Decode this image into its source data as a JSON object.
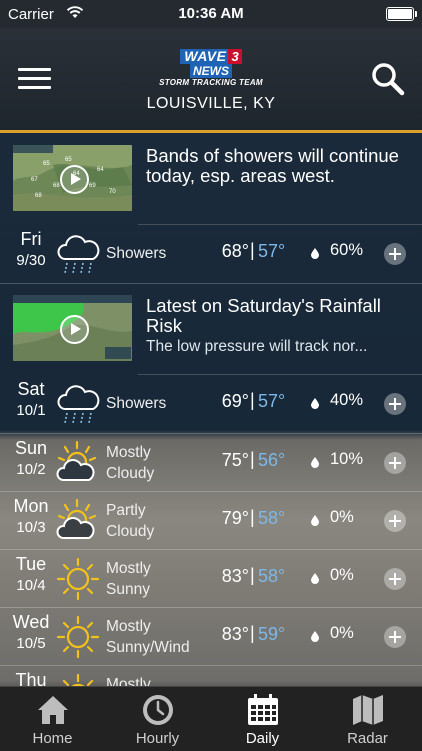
{
  "status_bar": {
    "carrier": "Carrier",
    "time": "10:36 AM"
  },
  "header": {
    "logo": {
      "wave": "WAVE",
      "three": "3",
      "news": "NEWS",
      "team": "STORM TRACKING TEAM"
    },
    "location": "LOUISVILLE, KY"
  },
  "stories": [
    {
      "headline": "Bands of showers will continue today, esp. areas west.",
      "summary": ""
    },
    {
      "headline": "Latest on Saturday's Rainfall Risk",
      "summary": "The low pressure will track nor..."
    }
  ],
  "days": [
    {
      "name": "Fri",
      "date": "9/30",
      "icon": "showers-icon",
      "condition": [
        "Showers"
      ],
      "high": "68°",
      "low": "57°",
      "precip": "60%"
    },
    {
      "name": "Sat",
      "date": "10/1",
      "icon": "showers-icon",
      "condition": [
        "Showers"
      ],
      "high": "69°",
      "low": "57°",
      "precip": "40%"
    },
    {
      "name": "Sun",
      "date": "10/2",
      "icon": "partly-cloudy-icon",
      "condition": [
        "Mostly",
        "Cloudy"
      ],
      "high": "75°",
      "low": "56°",
      "precip": "10%"
    },
    {
      "name": "Mon",
      "date": "10/3",
      "icon": "partly-cloudy-icon",
      "condition": [
        "Partly",
        "Cloudy"
      ],
      "high": "79°",
      "low": "58°",
      "precip": "0%"
    },
    {
      "name": "Tue",
      "date": "10/4",
      "icon": "sun-icon",
      "condition": [
        "Mostly",
        "Sunny"
      ],
      "high": "83°",
      "low": "58°",
      "precip": "0%"
    },
    {
      "name": "Wed",
      "date": "10/5",
      "icon": "sun-icon",
      "condition": [
        "Mostly",
        "Sunny/Wind"
      ],
      "high": "83°",
      "low": "59°",
      "precip": "0%"
    },
    {
      "name": "Thu",
      "date": "",
      "icon": "sun-icon",
      "condition": [
        "Mostly"
      ],
      "high": "",
      "low": "",
      "precip": ""
    }
  ],
  "tabs": [
    {
      "label": "Home",
      "icon": "home-icon"
    },
    {
      "label": "Hourly",
      "icon": "clock-icon"
    },
    {
      "label": "Daily",
      "icon": "calendar-icon",
      "active": true
    },
    {
      "label": "Radar",
      "icon": "map-icon"
    }
  ],
  "colors": {
    "accent_bar": "#d8a129",
    "low_temp": "#7db8e8",
    "sun": "#f2c21b"
  }
}
